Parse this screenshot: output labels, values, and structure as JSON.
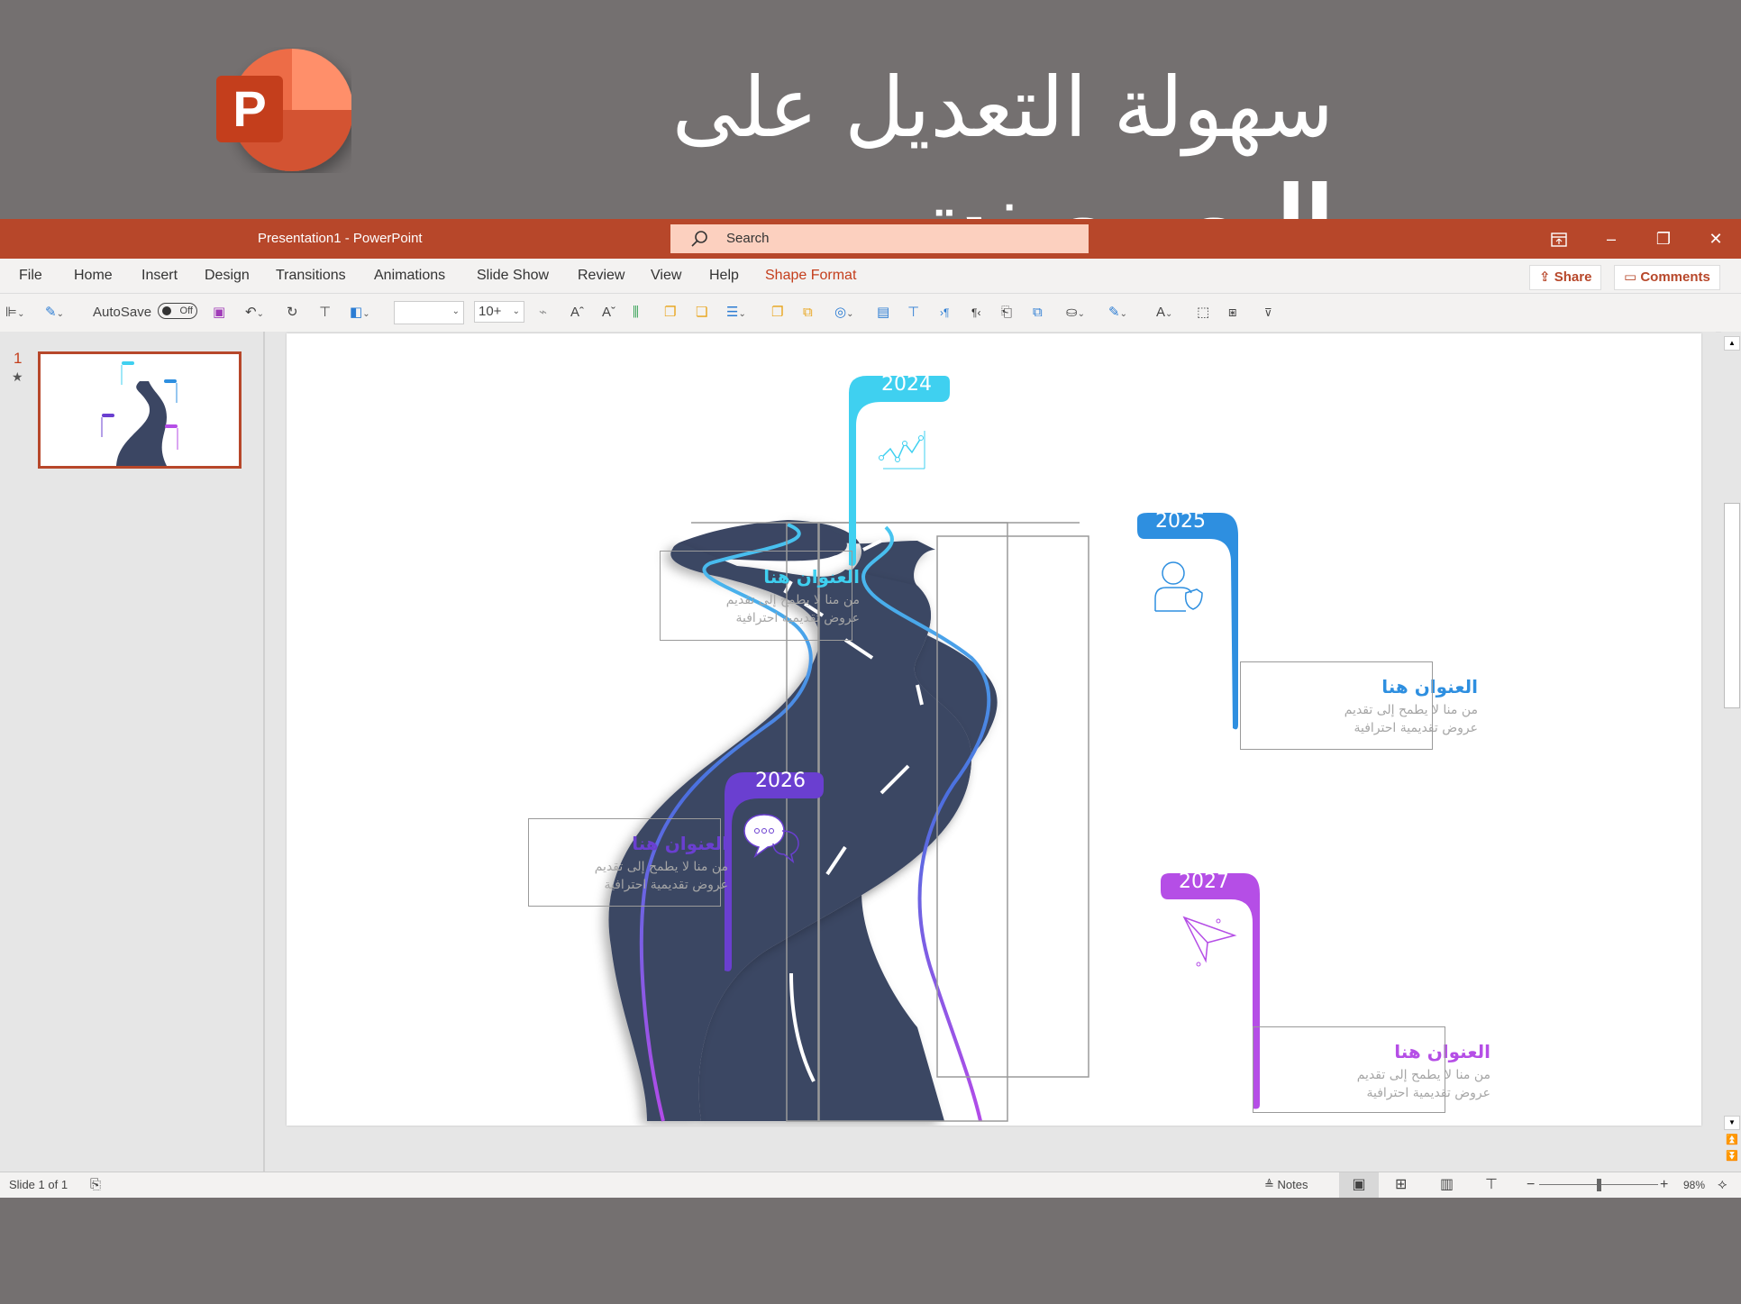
{
  "banner": {
    "title_light": "سهولة التعديل على",
    "title_bold": "البوربوينت",
    "logo_letter": "P"
  },
  "window": {
    "title": "Presentation1  -  PowerPoint",
    "search_placeholder": "Search",
    "controls": {
      "restore_ribbon": "ribbon-display-icon",
      "minimize": "–",
      "maximize": "❐",
      "close": "✕"
    }
  },
  "menu": {
    "items": [
      "File",
      "Home",
      "Insert",
      "Design",
      "Transitions",
      "Animations",
      "Slide Show",
      "Review",
      "View",
      "Help",
      "Shape Format"
    ],
    "active": "Shape Format",
    "share_label": "Share",
    "comments_label": "Comments"
  },
  "toolbar": {
    "autosave_label": "AutoSave",
    "autosave_state": "Off",
    "font_name": "",
    "font_size": "10+"
  },
  "slides_pane": {
    "slide_number": "1",
    "has_animation_star": "★"
  },
  "slide": {
    "cards": [
      {
        "year": "2024",
        "color": "#3fd0f0",
        "title": "العنوان هنا",
        "body_line1": "من منا لا يطمح إلى تقديم",
        "body_line2": "عروض تقديمية احترافية",
        "icon": "line-chart-icon"
      },
      {
        "year": "2025",
        "color": "#2e8fe0",
        "title": "العنوان هنا",
        "body_line1": "من منا لا يطمح إلى تقديم",
        "body_line2": "عروض تقديمية احترافية",
        "icon": "user-shield-icon"
      },
      {
        "year": "2026",
        "color": "#6a3fd0",
        "title": "العنوان هنا",
        "body_line1": "من منا لا يطمح إلى تقديم",
        "body_line2": "عروض تقديمية احترافية",
        "icon": "chat-bubbles-icon"
      },
      {
        "year": "2027",
        "color": "#b54ee6",
        "title": "العنوان هنا",
        "body_line1": "من منا لا يطمح إلى تقديم",
        "body_line2": "عروض تقديمية احترافية",
        "icon": "paper-plane-icon"
      }
    ],
    "road_color": "#3b4663"
  },
  "status": {
    "slide_indicator": "Slide 1 of 1",
    "notes_label": "Notes",
    "zoom_level": "98%",
    "zoom_fraction": 0.5
  },
  "colors": {
    "accent": "#b7472a",
    "banner_bg": "#747070"
  }
}
